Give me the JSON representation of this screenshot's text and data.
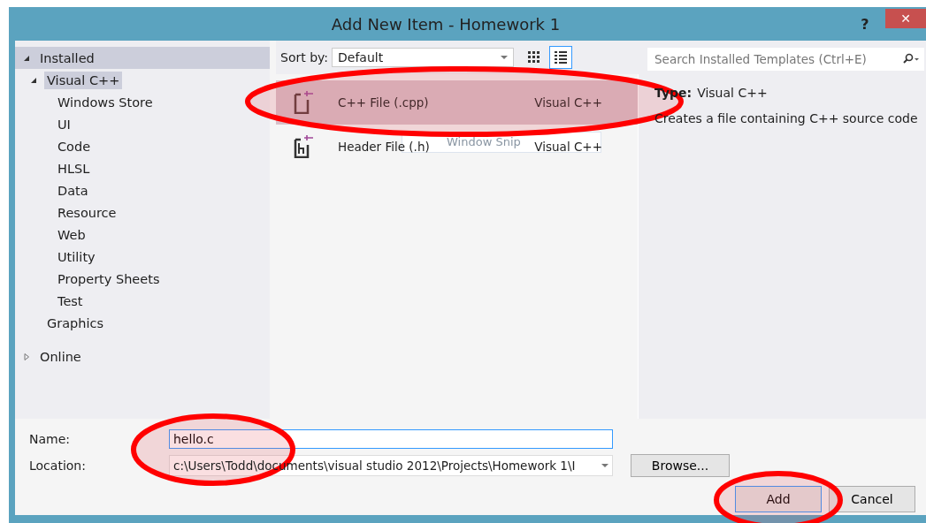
{
  "window": {
    "title": "Add New Item - Homework 1",
    "help": "?",
    "close": "✕"
  },
  "sidebar": {
    "items": [
      {
        "label": "Installed",
        "expanded": true,
        "kind": "header",
        "children": [
          {
            "label": "Visual C++",
            "expanded": true,
            "selected": true,
            "children": [
              {
                "label": "Windows Store",
                "selected": false
              },
              {
                "label": "UI",
                "selected": false
              },
              {
                "label": "Code",
                "selected": false
              },
              {
                "label": "HLSL",
                "selected": false
              },
              {
                "label": "Data",
                "selected": false
              },
              {
                "label": "Resource",
                "selected": false
              },
              {
                "label": "Web",
                "selected": false
              },
              {
                "label": "Utility",
                "selected": false
              },
              {
                "label": "Property Sheets",
                "selected": false
              },
              {
                "label": "Test",
                "selected": false
              }
            ]
          },
          {
            "label": "Graphics",
            "selected": false
          }
        ]
      },
      {
        "label": "Online",
        "expanded": false,
        "kind": "header"
      }
    ]
  },
  "toolbar": {
    "sort_label": "Sort by:",
    "sort_value": "Default",
    "view": [
      {
        "kind": "grid",
        "selected": false
      },
      {
        "kind": "list",
        "selected": true
      }
    ]
  },
  "search": {
    "placeholder": "Search Installed Templates (Ctrl+E)"
  },
  "templates": [
    {
      "name": "C++ File (.cpp)",
      "language": "Visual C++",
      "kind": "cpp",
      "selected": true
    },
    {
      "name": "Header File (.h)",
      "language": "Visual C++",
      "kind": "h",
      "selected": false
    }
  ],
  "tooltip": "Window Snip",
  "details": {
    "type_label": "Type:",
    "type_value": "Visual C++",
    "description": "Creates a file containing C++ source code"
  },
  "form": {
    "name_label": "Name:",
    "name_value": "hello.c",
    "location_label": "Location:",
    "location_value": "c:\\Users\\Todd\\documents\\visual studio 2012\\Projects\\Homework 1\\I",
    "browse": "Browse..."
  },
  "buttons": [
    {
      "label": "Add",
      "kind": "default"
    },
    {
      "label": "Cancel",
      "kind": "normal"
    }
  ]
}
